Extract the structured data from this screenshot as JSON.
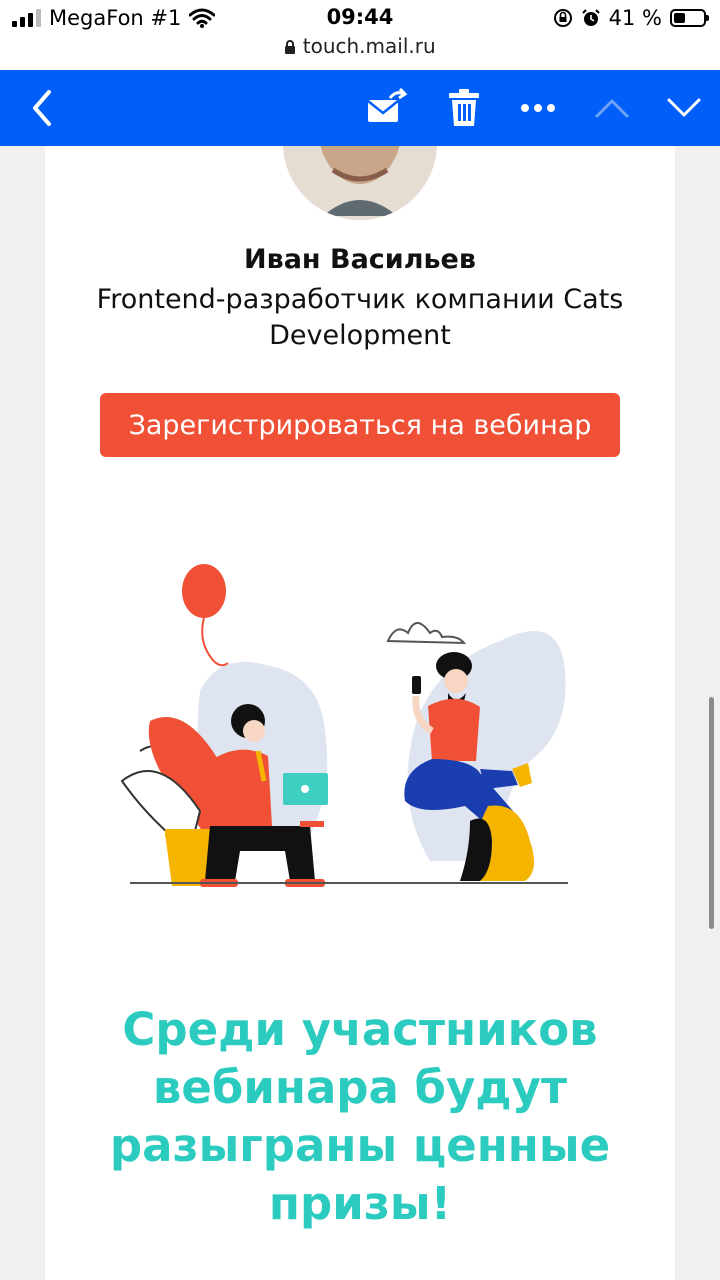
{
  "status_bar": {
    "carrier": "MegaFon #1",
    "time": "09:44",
    "battery_percent": "41 %",
    "battery_level": 0.41,
    "url": "touch.mail.ru"
  },
  "toolbar": {
    "icons": [
      "back-chevron-icon",
      "mark-unread-envelope-icon",
      "trash-icon",
      "more-dots-icon",
      "previous-chevron-up-icon",
      "next-chevron-down-icon"
    ],
    "color": "#005ff9"
  },
  "email": {
    "speaker_name": "Иван Васильев",
    "speaker_role": "Frontend-разработчик компании Cats Development",
    "register_button": "Зарегистрироваться на вебинар",
    "promo_text": "Среди участников вебинара будут разыграны ценные призы!",
    "accent_color": "#f05136",
    "promo_color": "#2ccbc0"
  }
}
